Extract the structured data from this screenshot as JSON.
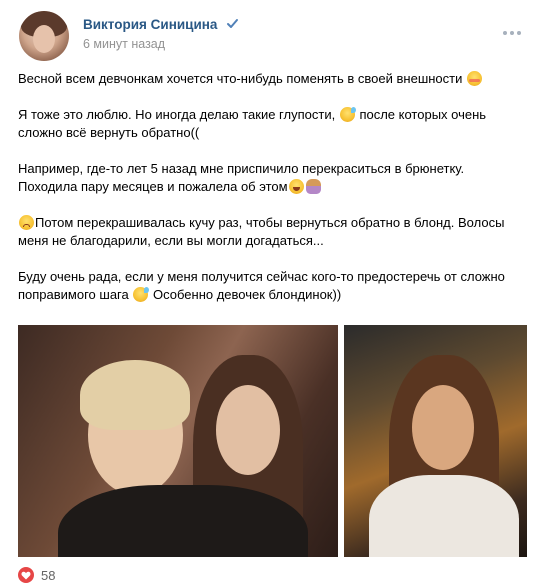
{
  "post": {
    "author": "Виктория Синицина",
    "time": "6 минут назад",
    "paragraphs": {
      "p1": "Весной всем девчонкам хочется что-нибудь поменять в своей внешности",
      "p2a": "Я тоже это люблю. Но иногда делаю такие глупости,",
      "p2b": "после которых очень сложно всё вернуть обратно((",
      "p3": "Например, где-то лет 5 назад мне приспичило перекраситься в брюнетку. Походила пару месяцев и пожалела об этом",
      "p4": "Потом перекрашивалась кучу раз, чтобы вернуться обратно в блонд. Волосы меня не благодарили, если вы могли догадаться...",
      "p5a": "Буду очень рада, если у меня получится сейчас кого-то предостеречь от сложно поправимого шага",
      "p5b": "Особенно девочек блондинок))"
    },
    "likes": "58"
  },
  "icons": {
    "verified": "verified-check-icon",
    "more": "more-dots-icon",
    "like": "heart-icon"
  },
  "colors": {
    "author": "#2a5885",
    "time": "#939393",
    "like": "#e64646",
    "verified": "#5181b8"
  }
}
